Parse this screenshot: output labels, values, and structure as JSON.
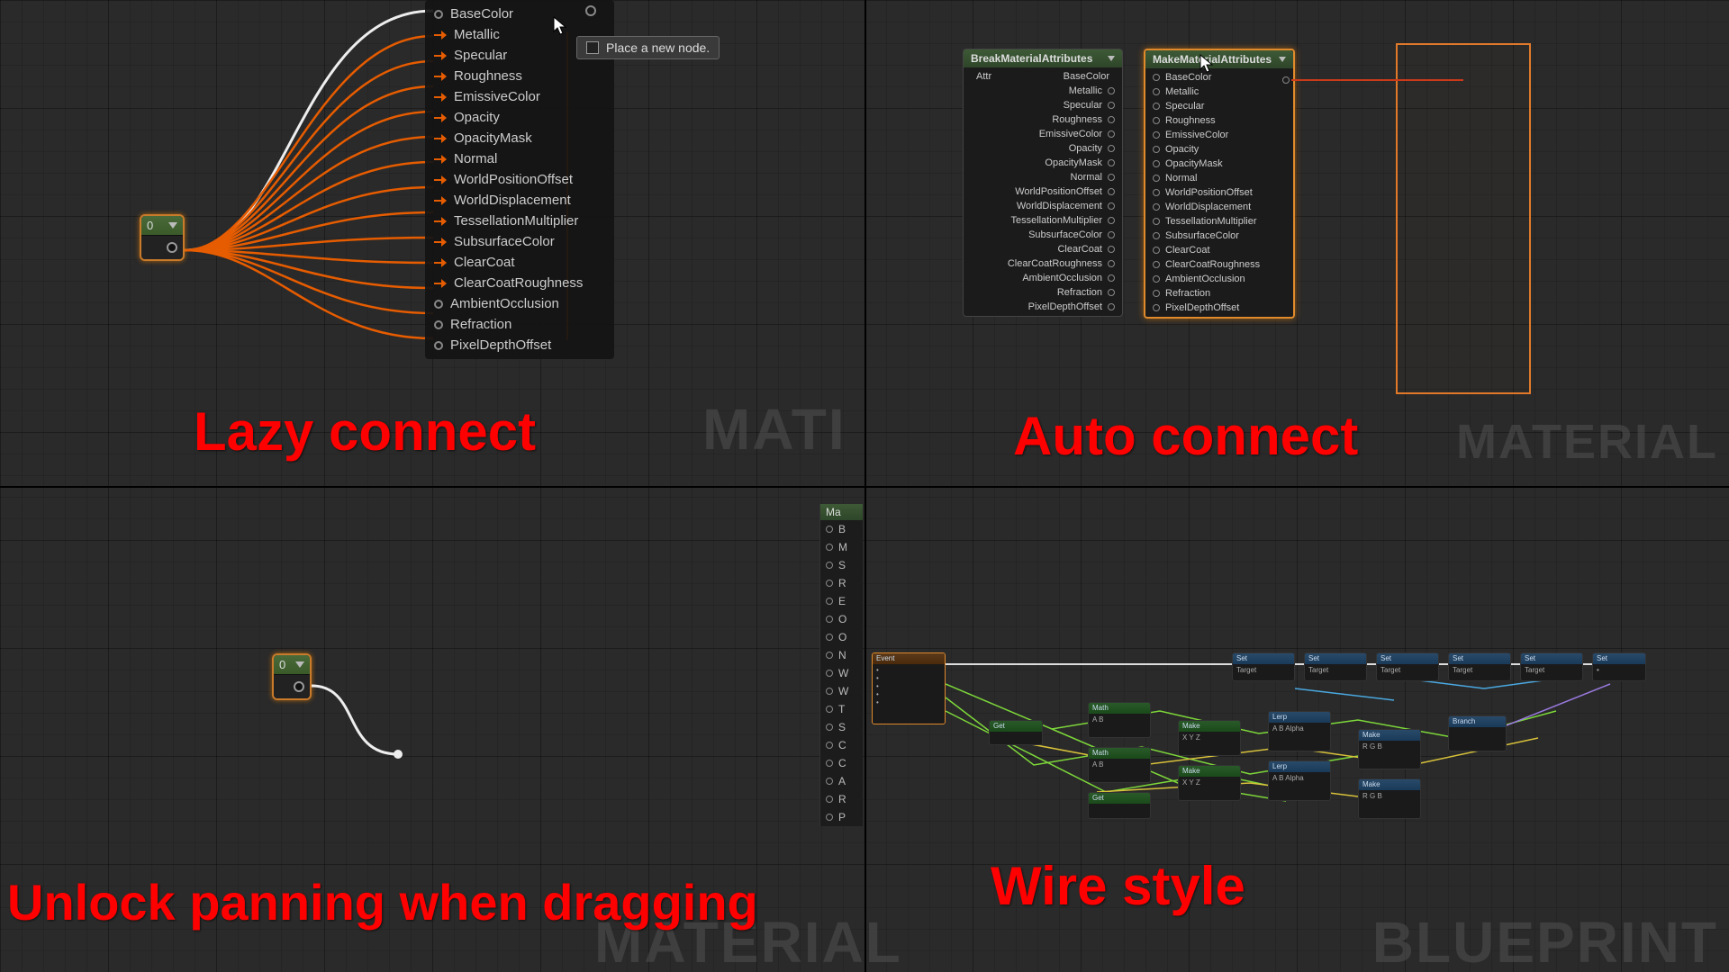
{
  "captions": {
    "lazy": "Lazy connect",
    "auto": "Auto connect",
    "unlock": "Unlock panning when dragging",
    "wire": "Wire style"
  },
  "watermarks": {
    "tl": "MATI",
    "tr": "MATERIAL",
    "bl": "MATERIAL",
    "br": "BLUEPRINT"
  },
  "const_node": {
    "value": "0"
  },
  "tooltip": {
    "text": "Place a new node."
  },
  "lazy_pins": [
    {
      "label": "BaseColor",
      "orange": false,
      "out": true
    },
    {
      "label": "Metallic",
      "orange": true
    },
    {
      "label": "Specular",
      "orange": true
    },
    {
      "label": "Roughness",
      "orange": true
    },
    {
      "label": "EmissiveColor",
      "orange": true
    },
    {
      "label": "Opacity",
      "orange": true
    },
    {
      "label": "OpacityMask",
      "orange": true
    },
    {
      "label": "Normal",
      "orange": true
    },
    {
      "label": "WorldPositionOffset",
      "orange": true
    },
    {
      "label": "WorldDisplacement",
      "orange": true
    },
    {
      "label": "TessellationMultiplier",
      "orange": true
    },
    {
      "label": "SubsurfaceColor",
      "orange": true
    },
    {
      "label": "ClearCoat",
      "orange": true
    },
    {
      "label": "ClearCoatRoughness",
      "orange": true
    },
    {
      "label": "AmbientOcclusion",
      "orange": false
    },
    {
      "label": "Refraction",
      "orange": false
    },
    {
      "label": "PixelDepthOffset",
      "orange": false
    }
  ],
  "break_node": {
    "title": "BreakMaterialAttributes",
    "input": "Attr",
    "outputs": [
      "BaseColor",
      "Metallic",
      "Specular",
      "Roughness",
      "EmissiveColor",
      "Opacity",
      "OpacityMask",
      "Normal",
      "WorldPositionOffset",
      "WorldDisplacement",
      "TessellationMultiplier",
      "SubsurfaceColor",
      "ClearCoat",
      "ClearCoatRoughness",
      "AmbientOcclusion",
      "Refraction",
      "PixelDepthOffset"
    ]
  },
  "make_node": {
    "title": "MakeMaterialAttributes",
    "inputs": [
      "BaseColor",
      "Metallic",
      "Specular",
      "Roughness",
      "EmissiveColor",
      "Opacity",
      "OpacityMask",
      "Normal",
      "WorldPositionOffset",
      "WorldDisplacement",
      "TessellationMultiplier",
      "SubsurfaceColor",
      "ClearCoat",
      "ClearCoatRoughness",
      "AmbientOcclusion",
      "Refraction",
      "PixelDepthOffset"
    ]
  },
  "cut_panel": {
    "head": "Ma",
    "rows": [
      "B",
      "M",
      "S",
      "R",
      "E",
      "O",
      "O",
      "N",
      "W",
      "W",
      "T",
      "S",
      "C",
      "C",
      "A",
      "R",
      "P"
    ]
  }
}
